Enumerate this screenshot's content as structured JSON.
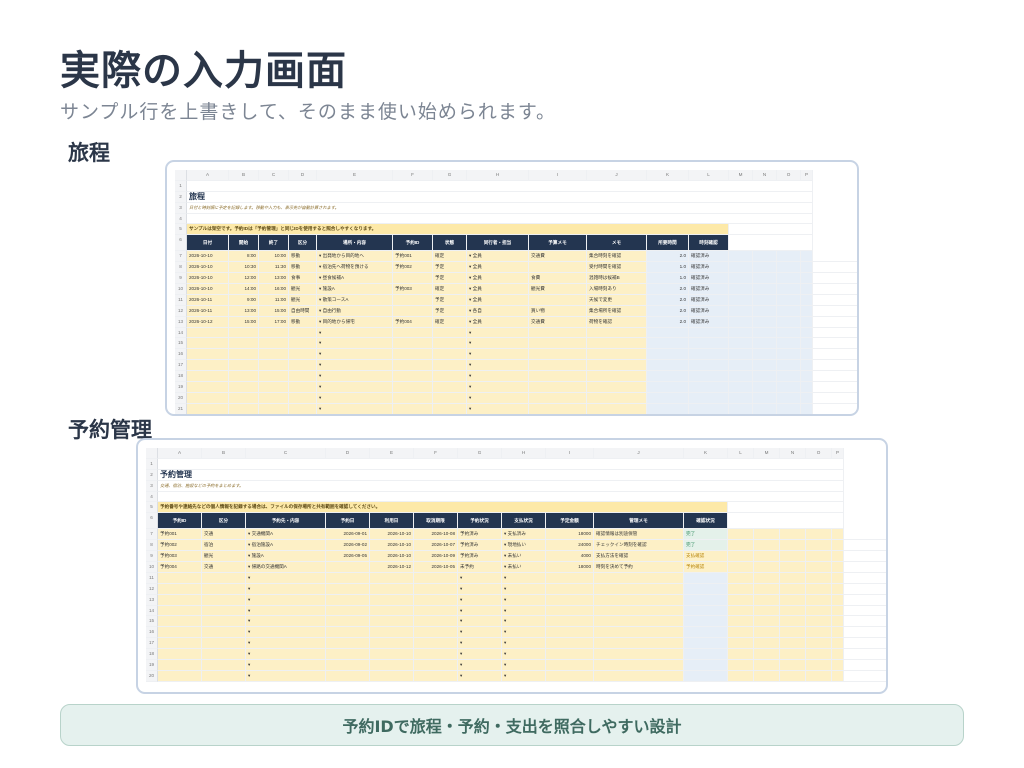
{
  "slide": {
    "title": "実際の入力画面",
    "subtitle": "サンプル行を上書きして、そのまま使い始められます。",
    "footer": "予約IDで旅程・予約・支出を照合しやすい設計"
  },
  "trip_section": {
    "label": "旅程",
    "sheet": {
      "columns": [
        "A",
        "B",
        "C",
        "D",
        "E",
        "F",
        "G",
        "H",
        "I",
        "J",
        "K",
        "L",
        "M",
        "N",
        "O",
        "P"
      ],
      "title": "旅程",
      "description": "日付と時刻順に予定を記録します。移動や入力も、表示先が自動計算されます。",
      "banner": "サンプルは架空です。予約IDは「予約管理」と同じIDを使用すると照合しやすくなります。",
      "headers": [
        "日付",
        "開始",
        "終了",
        "区分",
        "場所・内容",
        "予約ID",
        "状態",
        "同行者・担当",
        "予算メモ",
        "メモ",
        "所要時間",
        "時刻確認"
      ],
      "rows": [
        [
          "2026-10-10",
          "8:00",
          "10:00",
          "移動",
          "出発地から目的地へ",
          "予約001",
          "確定",
          "全員",
          "交通費",
          "集合時刻を確認",
          "2.0",
          "確認済み"
        ],
        [
          "2026-10-10",
          "10:30",
          "11:30",
          "移動",
          "宿泊先へ荷物を預ける",
          "予約002",
          "予定",
          "全員",
          "",
          "受付時間を確認",
          "1.0",
          "確認済み"
        ],
        [
          "2026-10-10",
          "12:00",
          "13:00",
          "食事",
          "昼食候補A",
          "",
          "予定",
          "全員",
          "食費",
          "混雑時は候補B",
          "1.0",
          "確認済み"
        ],
        [
          "2026-10-10",
          "14:00",
          "16:00",
          "観光",
          "施設A",
          "予約003",
          "確定",
          "全員",
          "観光費",
          "入場時刻あり",
          "2.0",
          "確認済み"
        ],
        [
          "2026-10-11",
          "9:00",
          "11:00",
          "観光",
          "散策コースA",
          "",
          "予定",
          "全員",
          "",
          "天候で変更",
          "2.0",
          "確認済み"
        ],
        [
          "2026-10-11",
          "13:00",
          "15:00",
          "自由時間",
          "自由行動",
          "",
          "予定",
          "各自",
          "買い物",
          "集合場所を確認",
          "2.0",
          "確認済み"
        ],
        [
          "2026-10-12",
          "15:00",
          "17:00",
          "移動",
          "目的地から帰宅",
          "予約004",
          "確定",
          "全員",
          "交通費",
          "荷物を確認",
          "2.0",
          "確認済み"
        ]
      ]
    }
  },
  "reservation_section": {
    "label": "予約管理",
    "sheet": {
      "columns": [
        "A",
        "B",
        "C",
        "D",
        "E",
        "F",
        "G",
        "H",
        "I",
        "J",
        "K",
        "L",
        "M",
        "N",
        "O",
        "P"
      ],
      "title": "予約管理",
      "description": "交通、宿泊、施設などの予約をまとめます。",
      "banner": "予約番号や連絡先などの個人情報を記録する場合は、ファイルの保存場所と共有範囲を確認してください。",
      "headers": [
        "予約ID",
        "区分",
        "予約先・内容",
        "予約日",
        "利用日",
        "取消期限",
        "予約状況",
        "支払状況",
        "予定金額",
        "管理メモ",
        "確認状況"
      ],
      "rows": [
        [
          "予約001",
          "交通",
          "交通機関A",
          "2026-09-01",
          "2026-10-10",
          "2026-10-08",
          "予約済み",
          "支払済み",
          "18000",
          "確認情報は別途保管",
          "完了"
        ],
        [
          "予約002",
          "宿泊",
          "宿泊施設A",
          "2026-09-02",
          "2026-10-10",
          "2026-10-07",
          "予約済み",
          "現地払い",
          "24000",
          "チェックイン時刻を確認",
          "完了"
        ],
        [
          "予約003",
          "観光",
          "施設A",
          "2026-09-05",
          "2026-10-10",
          "2026-10-09",
          "予約済み",
          "未払い",
          "4000",
          "支払方法を確認",
          "支払確認"
        ],
        [
          "予約004",
          "交通",
          "帰路の交通機関A",
          "",
          "2026-10-12",
          "2026-10-05",
          "未予約",
          "未払い",
          "18000",
          "時刻を決めて予約",
          "予約確認"
        ]
      ]
    }
  }
}
